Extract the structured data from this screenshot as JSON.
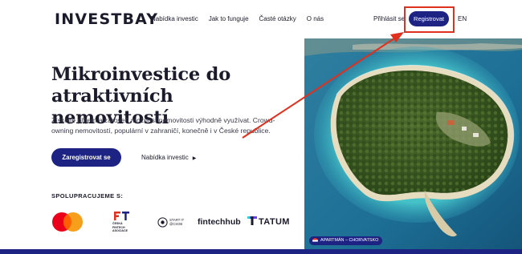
{
  "header": {
    "logo": "INVESTBAY",
    "nav": [
      "Nabídka investic",
      "Jak to funguje",
      "Časté otázky",
      "O nás"
    ],
    "login": "Přihlásit se",
    "register": "Registrovat",
    "language": "EN"
  },
  "hero": {
    "title": "Mikroinvestice do atraktivních nemovitostí",
    "description": "Získejte příjem a zároveň možnost nemovitosti výhodně využívat. Crowd-owning nemovitostí, populární v zahraničí, konečně i v České republice.",
    "cta_primary": "Zaregistrovat se",
    "cta_secondary": "Nabídka investic",
    "cta_secondary_icon": "chevron-right-icon"
  },
  "partners": {
    "label": "SPOLUPRACUJEME S:",
    "fintech_text": "ČESKÁ\nFINTECH\nASOCIACE",
    "startit_text": "START IT\n@CSOB",
    "fintechhub": "fintechhub",
    "tatum": "TATUM"
  },
  "photo": {
    "badge": "APARTMÁN – CHORVATSKO"
  },
  "colors": {
    "brand": "#1d2383",
    "highlight": "#e0301e",
    "sea": "#1a6a8e"
  }
}
